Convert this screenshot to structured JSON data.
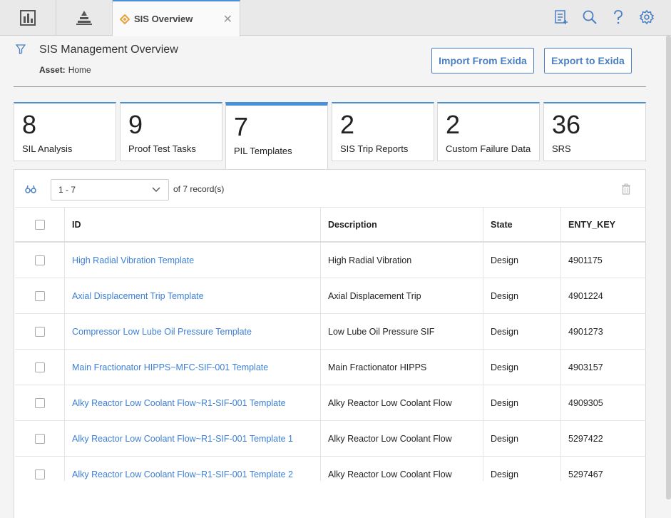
{
  "topbar": {
    "active_tab_label": "SIS Overview"
  },
  "header": {
    "title": "SIS Management Overview",
    "asset_label": "Asset:",
    "asset_value": "Home",
    "import_button": "Import From Exida",
    "export_button": "Export to Exida"
  },
  "cards": [
    {
      "count": "8",
      "label": "SIL Analysis"
    },
    {
      "count": "9",
      "label": "Proof Test Tasks"
    },
    {
      "count": "7",
      "label": "PIL Templates"
    },
    {
      "count": "2",
      "label": "SIS Trip Reports"
    },
    {
      "count": "2",
      "label": "Custom Failure Data"
    },
    {
      "count": "36",
      "label": "SRS"
    }
  ],
  "pager": {
    "range": "1 - 7",
    "of_label": "of",
    "total": "7",
    "records_label": "record(s)"
  },
  "table": {
    "columns": [
      "ID",
      "Description",
      "State",
      "ENTY_KEY"
    ],
    "rows": [
      {
        "id": "High Radial Vibration Template",
        "description": "High Radial Vibration",
        "state": "Design",
        "key": "4901175"
      },
      {
        "id": "Axial Displacement Trip Template",
        "description": "Axial Displacement Trip",
        "state": "Design",
        "key": "4901224"
      },
      {
        "id": "Compressor Low Lube Oil Pressure Template",
        "description": "Low Lube Oil Pressure SIF",
        "state": "Design",
        "key": "4901273"
      },
      {
        "id": "Main Fractionator HIPPS~MFC-SIF-001 Template",
        "description": "Main Fractionator HIPPS",
        "state": "Design",
        "key": "4903157"
      },
      {
        "id": "Alky Reactor Low Coolant Flow~R1-SIF-001 Template",
        "description": "Alky Reactor Low Coolant Flow",
        "state": "Design",
        "key": "4909305"
      },
      {
        "id": "Alky Reactor Low Coolant Flow~R1-SIF-001 Template 1",
        "description": "Alky Reactor Low Coolant Flow",
        "state": "Design",
        "key": "5297422"
      },
      {
        "id": "Alky Reactor Low Coolant Flow~R1-SIF-001 Template 2",
        "description": "Alky Reactor Low Coolant Flow",
        "state": "Design",
        "key": "5297467"
      }
    ]
  }
}
